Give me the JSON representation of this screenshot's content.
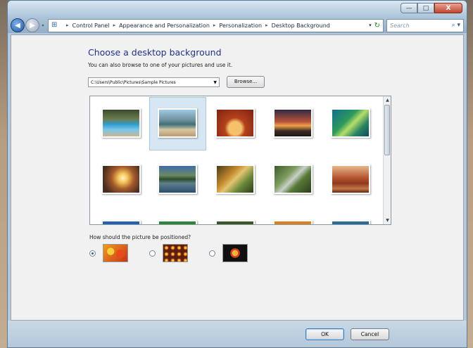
{
  "window": {
    "minimize": "—",
    "maximize": "□",
    "close": "X"
  },
  "nav": {
    "breadcrumbs": [
      "Control Panel",
      "Appearance and Personalization",
      "Personalization",
      "Desktop Background"
    ],
    "search_placeholder": "Search"
  },
  "page": {
    "title": "Choose a desktop background",
    "subtitle": "You can also browse to one of your pictures and use it.",
    "location_value": "C:\\Users\\Public\\Pictures\\Sample Pictures",
    "browse_label": "Browse...",
    "position_label": "How should the picture be positioned?"
  },
  "gallery": {
    "selected_index": 1,
    "images": [
      "pool",
      "beach",
      "arch",
      "sunset",
      "leaf",
      "sunrise",
      "lake",
      "autumn",
      "creek",
      "butte",
      "blue",
      "green",
      "forest",
      "orange",
      "teal"
    ]
  },
  "positions": {
    "options": [
      "fill",
      "tile",
      "center"
    ],
    "selected": "fill"
  },
  "footer": {
    "ok_label": "OK",
    "cancel_label": "Cancel"
  },
  "colors": {
    "title": "#1e3287",
    "selection": "#d7e6f3",
    "window_frame": "#b3c8da"
  }
}
